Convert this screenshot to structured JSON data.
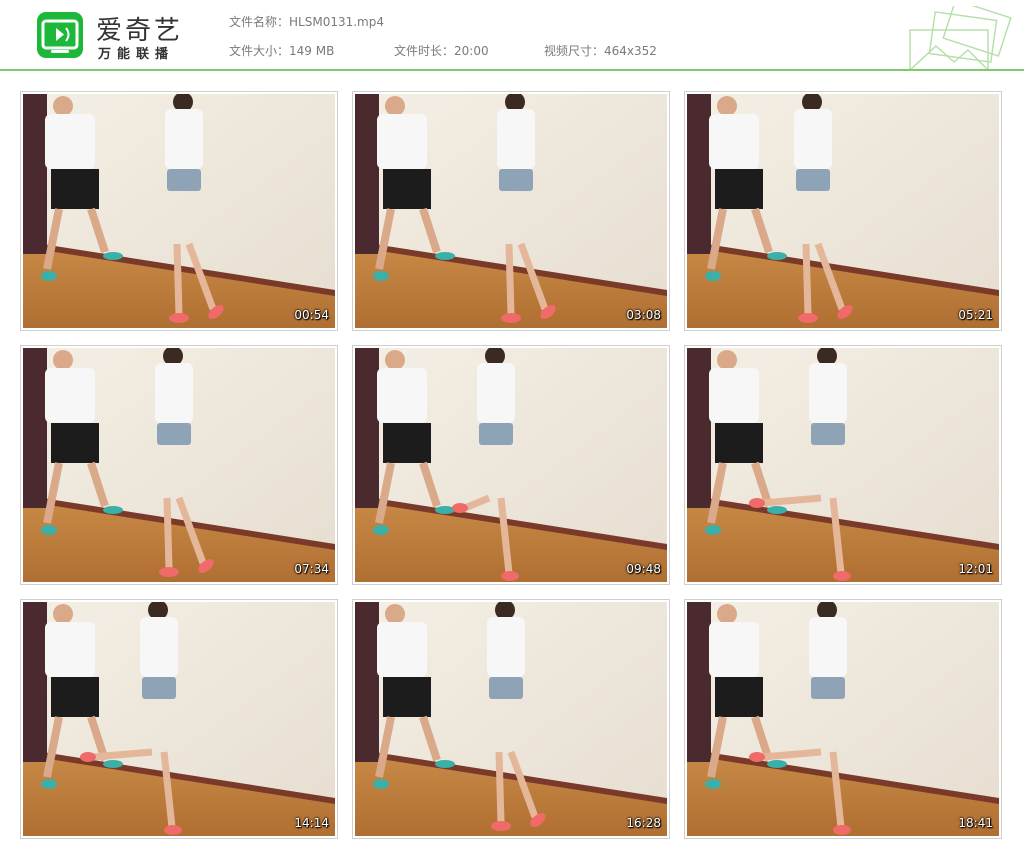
{
  "brand": {
    "name": "爱奇艺",
    "tagline": "万能联播",
    "logo_icon": "iqiyi-tv-icon",
    "color": "#1db83a"
  },
  "file_info": {
    "name_label": "文件名称：",
    "name_value": "HLSM0131.mp4",
    "size_label": "文件大小：",
    "size_value": "149 MB",
    "duration_label": "文件时长：",
    "duration_value": "20:00",
    "resolution_label": "视频尺寸：",
    "resolution_value": "464x352"
  },
  "accent_color": "#7ec86e",
  "thumbnails": [
    {
      "timestamp": "00:54"
    },
    {
      "timestamp": "03:08"
    },
    {
      "timestamp": "05:21"
    },
    {
      "timestamp": "07:34"
    },
    {
      "timestamp": "09:48"
    },
    {
      "timestamp": "12:01"
    },
    {
      "timestamp": "14:14"
    },
    {
      "timestamp": "16:28"
    },
    {
      "timestamp": "18:41"
    }
  ]
}
